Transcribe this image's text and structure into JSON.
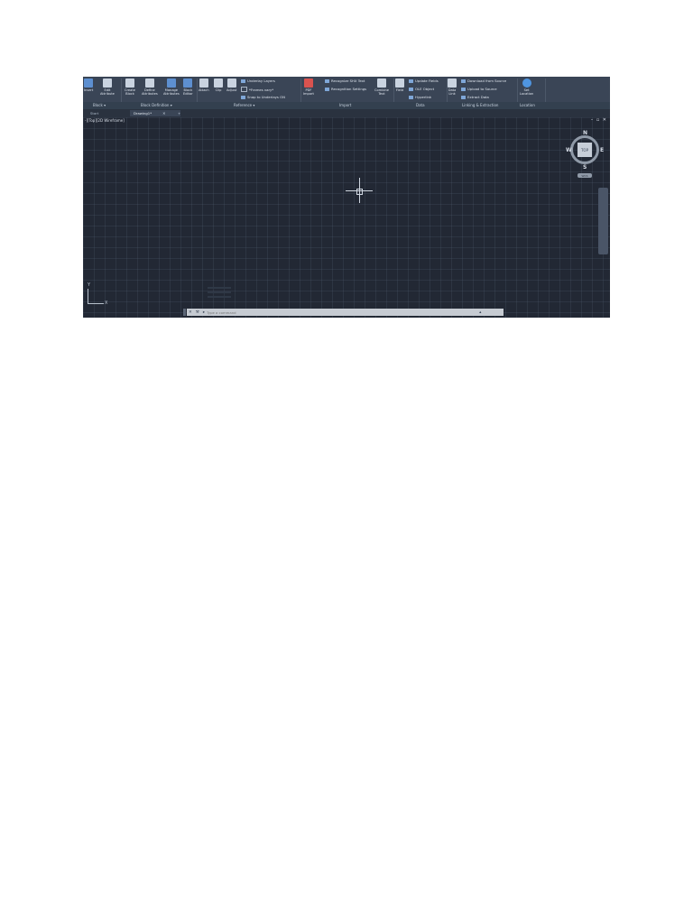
{
  "ribbon": {
    "block_panel": {
      "insert_label": "Insert",
      "edit_attribute_label": "Edit\nAttribute",
      "panel_title": "Block ▾"
    },
    "block_definition_panel": {
      "create_block_label": "Create\nBlock",
      "define_attributes_label": "Define\nAttributes",
      "manage_attributes_label": "Manage\nAttributes",
      "block_editor_label": "Block\nEditor",
      "panel_title": "Block Definition ▾"
    },
    "reference_panel": {
      "attach_label": "Attach",
      "clip_label": "Clip",
      "adjust_label": "Adjust",
      "underlay_layers_label": "Underlay Layers",
      "frames_vary_label": "*Frames vary*",
      "snap_to_underlays_label": "Snap to Underlays ON",
      "panel_title": "Reference ▾"
    },
    "import_panel": {
      "pdf_import_label": "PDF\nImport",
      "recognize_shx_label": "Recognize SHX Text",
      "recognition_settings_label": "Recognition Settings",
      "combine_text_label": "Combine\nText",
      "panel_title": "Import"
    },
    "data_panel": {
      "field_label": "Field",
      "update_fields_label": "Update Fields",
      "ole_object_label": "OLE Object",
      "hyperlink_label": "Hyperlink",
      "panel_title": "Data"
    },
    "linking_panel": {
      "data_link_label": "Data\nLink",
      "download_label": "Download from Source",
      "upload_label": "Upload to Source",
      "extract_data_label": "Extract  Data",
      "panel_title": "Linking & Extraction"
    },
    "location_panel": {
      "set_location_label": "Set\nLocation",
      "panel_title": "Location"
    }
  },
  "tabs": [
    {
      "label": "Start"
    },
    {
      "label": "Drawing1*"
    }
  ],
  "tab_add": "+",
  "tab_close": "✕",
  "viewport": {
    "view_label": "-][Top][2D Wireframe]",
    "window_controls": "– ▫ ✕"
  },
  "viewcube": {
    "north": "N",
    "south": "S",
    "east": "E",
    "west": "W",
    "top_face": "TOP",
    "wcs": "WCS"
  },
  "ucs": {
    "x": "X",
    "y": "Y"
  },
  "command_line": {
    "close": "✕",
    "customize": "⚒",
    "recent": "▸",
    "placeholder": "Type a command",
    "expand": "▴"
  },
  "colors": {
    "background": "#222834",
    "ribbon": "#3a4556",
    "accent": "#5d8fd0"
  }
}
